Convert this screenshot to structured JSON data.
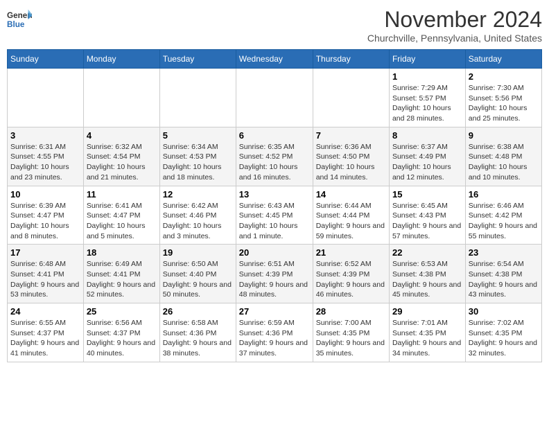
{
  "logo": {
    "general": "General",
    "blue": "Blue"
  },
  "title": "November 2024",
  "location": "Churchville, Pennsylvania, United States",
  "days_of_week": [
    "Sunday",
    "Monday",
    "Tuesday",
    "Wednesday",
    "Thursday",
    "Friday",
    "Saturday"
  ],
  "weeks": [
    [
      {
        "day": "",
        "info": ""
      },
      {
        "day": "",
        "info": ""
      },
      {
        "day": "",
        "info": ""
      },
      {
        "day": "",
        "info": ""
      },
      {
        "day": "",
        "info": ""
      },
      {
        "day": "1",
        "info": "Sunrise: 7:29 AM\nSunset: 5:57 PM\nDaylight: 10 hours and 28 minutes."
      },
      {
        "day": "2",
        "info": "Sunrise: 7:30 AM\nSunset: 5:56 PM\nDaylight: 10 hours and 25 minutes."
      }
    ],
    [
      {
        "day": "3",
        "info": "Sunrise: 6:31 AM\nSunset: 4:55 PM\nDaylight: 10 hours and 23 minutes."
      },
      {
        "day": "4",
        "info": "Sunrise: 6:32 AM\nSunset: 4:54 PM\nDaylight: 10 hours and 21 minutes."
      },
      {
        "day": "5",
        "info": "Sunrise: 6:34 AM\nSunset: 4:53 PM\nDaylight: 10 hours and 18 minutes."
      },
      {
        "day": "6",
        "info": "Sunrise: 6:35 AM\nSunset: 4:52 PM\nDaylight: 10 hours and 16 minutes."
      },
      {
        "day": "7",
        "info": "Sunrise: 6:36 AM\nSunset: 4:50 PM\nDaylight: 10 hours and 14 minutes."
      },
      {
        "day": "8",
        "info": "Sunrise: 6:37 AM\nSunset: 4:49 PM\nDaylight: 10 hours and 12 minutes."
      },
      {
        "day": "9",
        "info": "Sunrise: 6:38 AM\nSunset: 4:48 PM\nDaylight: 10 hours and 10 minutes."
      }
    ],
    [
      {
        "day": "10",
        "info": "Sunrise: 6:39 AM\nSunset: 4:47 PM\nDaylight: 10 hours and 8 minutes."
      },
      {
        "day": "11",
        "info": "Sunrise: 6:41 AM\nSunset: 4:47 PM\nDaylight: 10 hours and 5 minutes."
      },
      {
        "day": "12",
        "info": "Sunrise: 6:42 AM\nSunset: 4:46 PM\nDaylight: 10 hours and 3 minutes."
      },
      {
        "day": "13",
        "info": "Sunrise: 6:43 AM\nSunset: 4:45 PM\nDaylight: 10 hours and 1 minute."
      },
      {
        "day": "14",
        "info": "Sunrise: 6:44 AM\nSunset: 4:44 PM\nDaylight: 9 hours and 59 minutes."
      },
      {
        "day": "15",
        "info": "Sunrise: 6:45 AM\nSunset: 4:43 PM\nDaylight: 9 hours and 57 minutes."
      },
      {
        "day": "16",
        "info": "Sunrise: 6:46 AM\nSunset: 4:42 PM\nDaylight: 9 hours and 55 minutes."
      }
    ],
    [
      {
        "day": "17",
        "info": "Sunrise: 6:48 AM\nSunset: 4:41 PM\nDaylight: 9 hours and 53 minutes."
      },
      {
        "day": "18",
        "info": "Sunrise: 6:49 AM\nSunset: 4:41 PM\nDaylight: 9 hours and 52 minutes."
      },
      {
        "day": "19",
        "info": "Sunrise: 6:50 AM\nSunset: 4:40 PM\nDaylight: 9 hours and 50 minutes."
      },
      {
        "day": "20",
        "info": "Sunrise: 6:51 AM\nSunset: 4:39 PM\nDaylight: 9 hours and 48 minutes."
      },
      {
        "day": "21",
        "info": "Sunrise: 6:52 AM\nSunset: 4:39 PM\nDaylight: 9 hours and 46 minutes."
      },
      {
        "day": "22",
        "info": "Sunrise: 6:53 AM\nSunset: 4:38 PM\nDaylight: 9 hours and 45 minutes."
      },
      {
        "day": "23",
        "info": "Sunrise: 6:54 AM\nSunset: 4:38 PM\nDaylight: 9 hours and 43 minutes."
      }
    ],
    [
      {
        "day": "24",
        "info": "Sunrise: 6:55 AM\nSunset: 4:37 PM\nDaylight: 9 hours and 41 minutes."
      },
      {
        "day": "25",
        "info": "Sunrise: 6:56 AM\nSunset: 4:37 PM\nDaylight: 9 hours and 40 minutes."
      },
      {
        "day": "26",
        "info": "Sunrise: 6:58 AM\nSunset: 4:36 PM\nDaylight: 9 hours and 38 minutes."
      },
      {
        "day": "27",
        "info": "Sunrise: 6:59 AM\nSunset: 4:36 PM\nDaylight: 9 hours and 37 minutes."
      },
      {
        "day": "28",
        "info": "Sunrise: 7:00 AM\nSunset: 4:35 PM\nDaylight: 9 hours and 35 minutes."
      },
      {
        "day": "29",
        "info": "Sunrise: 7:01 AM\nSunset: 4:35 PM\nDaylight: 9 hours and 34 minutes."
      },
      {
        "day": "30",
        "info": "Sunrise: 7:02 AM\nSunset: 4:35 PM\nDaylight: 9 hours and 32 minutes."
      }
    ]
  ]
}
